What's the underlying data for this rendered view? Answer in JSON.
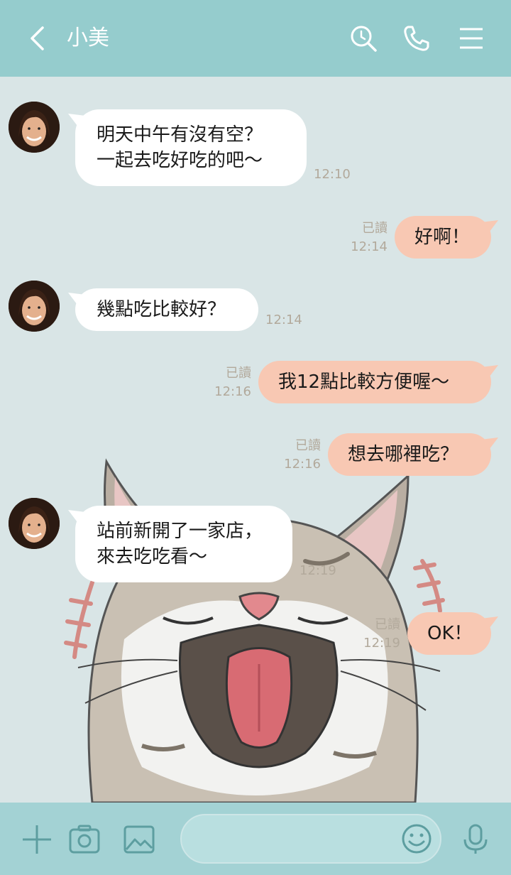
{
  "header": {
    "title": "小美",
    "icons": [
      "back-arrow-icon",
      "search-icon",
      "phone-icon",
      "menu-icon"
    ]
  },
  "colors": {
    "header_bg": "#95cccd",
    "chat_bg": "#d9e5e6",
    "incoming_bubble": "#ffffff",
    "outgoing_bubble": "#f8c8b3",
    "bottom_bar": "#a3d2d4",
    "meta_text": "#b2a99b"
  },
  "messages": [
    {
      "from": "friend",
      "lines": [
        "明天中午有沒有空？",
        "一起去吃好吃的吧～"
      ],
      "time": "12:10"
    },
    {
      "from": "me",
      "text": "好啊！",
      "read": "已讀",
      "time": "12:14"
    },
    {
      "from": "friend",
      "lines": [
        "幾點吃比較好？"
      ],
      "time": "12:14"
    },
    {
      "from": "me",
      "text": "我12點比較方便喔～",
      "read": "已讀",
      "time": "12:16"
    },
    {
      "from": "me",
      "text": "想去哪裡吃？",
      "read": "已讀",
      "time": "12:16"
    },
    {
      "from": "friend",
      "lines": [
        "站前新開了一家店，",
        "來去吃吃看～"
      ],
      "time": "12:19"
    },
    {
      "from": "me",
      "text": "OK！",
      "read": "已讀",
      "time": "12:19"
    }
  ],
  "composer": {
    "placeholder": "",
    "icons": [
      "plus-icon",
      "camera-icon",
      "image-icon",
      "emoji-icon",
      "microphone-icon"
    ]
  }
}
